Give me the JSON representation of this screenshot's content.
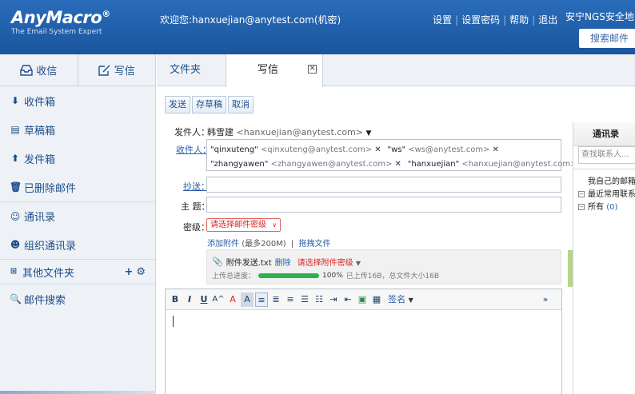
{
  "header": {
    "logo_main": "AnyMacro",
    "logo_reg": "®",
    "logo_sub": "The Email System Expert",
    "welcome": "欢迎您:hanxuejian@anytest.com(机密)",
    "links": [
      "设置",
      "设置密码",
      "帮助",
      "退出"
    ],
    "brand": "安宁NGS安全地",
    "search_mail": "搜索邮件"
  },
  "sidebar": {
    "tab_inbox": "收信",
    "tab_compose": "写信",
    "items": [
      "收件箱",
      "草稿箱",
      "发件箱",
      "已删除邮件",
      "通讯录",
      "组织通讯录"
    ],
    "other_folders": "其他文件夹",
    "mail_search": "邮件搜索"
  },
  "tabs": {
    "folder": "文件夹",
    "compose": "写信"
  },
  "toolbar": {
    "send": "发送",
    "save_draft": "存草稿",
    "cancel": "取消"
  },
  "form": {
    "from_label": "发件人：",
    "from_name": "韩雪建",
    "from_email": "<hanxuejian@anytest.com>",
    "to_label": "收件人：",
    "recipients": [
      {
        "name": "\"qinxuteng\"",
        "email": "<qinxuteng@anytest.com>"
      },
      {
        "name": "\"ws\"",
        "email": "<ws@anytest.com>"
      },
      {
        "name": "\"zhangyawen\"",
        "email": "<zhangyawen@anytest.com>"
      },
      {
        "name": "\"hanxuejian\"",
        "email": "<hanxuejian@anytest.com>"
      }
    ],
    "cc_label": "抄送：",
    "subject_label": "主 题：",
    "level_label": "密级：",
    "level_placeholder": "请选择邮件密级",
    "add_attachment": "添加附件",
    "attachment_limit": "(最多200M)",
    "drag_file": "拖拽文件",
    "link_sep": "|",
    "attachment": {
      "filename": "附件发送.txt",
      "delete": "删除",
      "level_placeholder": "请选择附件密级",
      "progress_label": "上传总进度：",
      "progress_text": "100%",
      "progress_value": 1.0,
      "upload_info": "已上传16B，总文件大小16B"
    }
  },
  "editor": {
    "buttons": [
      "B",
      "I",
      "U",
      "A^",
      "A",
      "A"
    ],
    "signature": "签名"
  },
  "contacts": {
    "title": "通讯录",
    "search_placeholder": "查找联系人...",
    "my_mailboxes": "我自己的邮箱",
    "recent": "最近常用联系",
    "all": "所有",
    "all_count": "(0)"
  },
  "colors": {
    "header_bg": "#1d5fa8",
    "link_blue": "#2a5fa6",
    "alert_red": "#dd2222",
    "progress_green": "#2bb24c"
  }
}
